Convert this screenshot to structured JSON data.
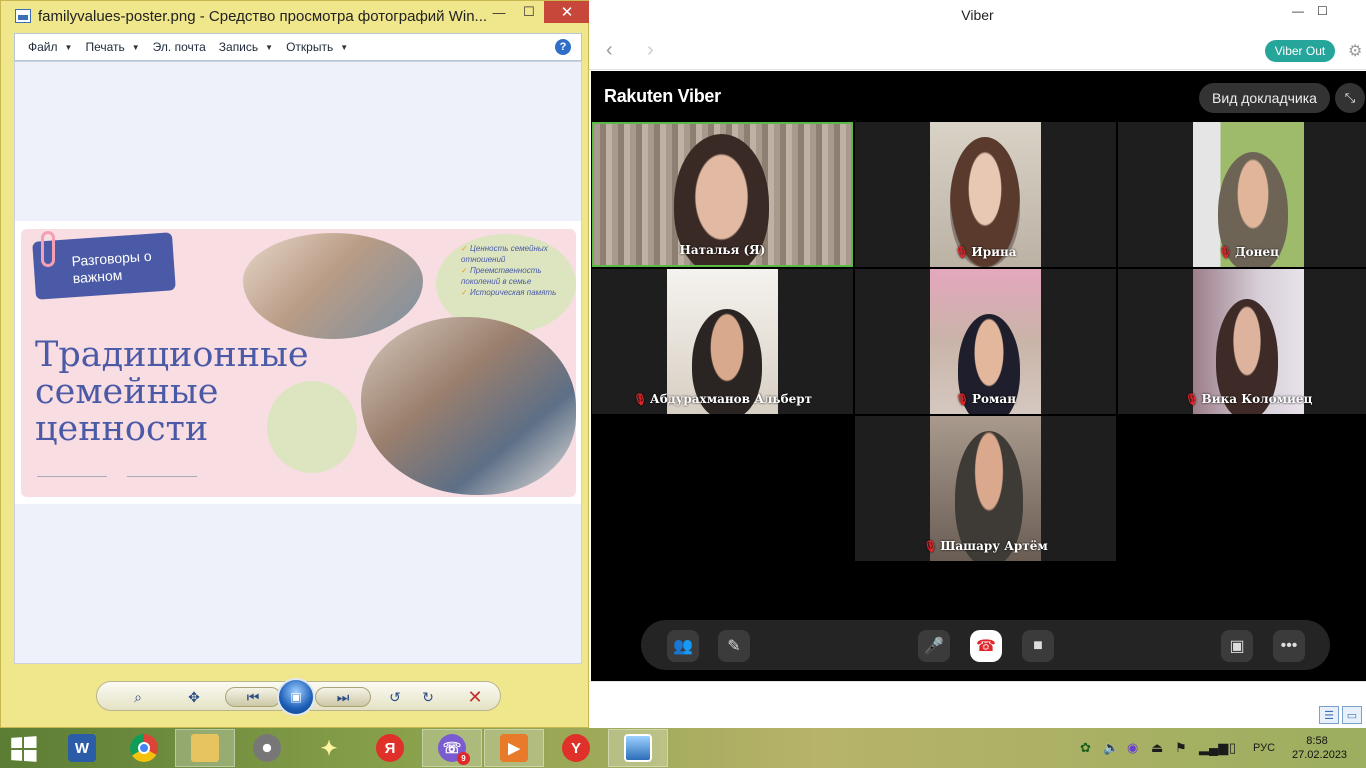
{
  "photo_viewer": {
    "title": "familyvalues-poster.png - Средство просмотра фотографий Win...",
    "menu": [
      {
        "label": "Файл",
        "has_caret": true
      },
      {
        "label": "Печать",
        "has_caret": true
      },
      {
        "label": "Эл. почта",
        "has_caret": false
      },
      {
        "label": "Запись",
        "has_caret": true
      },
      {
        "label": "Открыть",
        "has_caret": true
      }
    ],
    "poster": {
      "badge": "Разговоры о важном",
      "title_line1": "Традиционные",
      "title_line2": "семейные",
      "title_line3": "ценности",
      "list": [
        "Ценность семейных отношений",
        "Преемственность поколений в семье",
        "Историческая память"
      ]
    }
  },
  "viber": {
    "window_title": "Viber",
    "viber_out_label": "Viber Out",
    "brand": "Rakuten Viber",
    "speaker_view_label": "Вид докладчика",
    "participants": [
      {
        "name": "Наталья (Я)",
        "muted": false,
        "active": true
      },
      {
        "name": "Ирина",
        "muted": true,
        "active": false
      },
      {
        "name": "Донец",
        "muted": true,
        "active": false
      },
      {
        "name": "Абдурахманов Альберт",
        "muted": true,
        "active": false
      },
      {
        "name": "Роман",
        "muted": true,
        "active": false
      },
      {
        "name": "Вика Коломиец",
        "muted": true,
        "active": false
      },
      {
        "name": "Шашару Артём",
        "muted": true,
        "active": false
      }
    ],
    "controls": [
      "add-participant",
      "edit",
      "microphone",
      "end-call",
      "camera",
      "screen-share",
      "more"
    ],
    "colors": {
      "viber_out": "#26a59a",
      "active_border": "#5aba45",
      "end_call": "#e0262b"
    }
  },
  "taskbar": {
    "apps": [
      {
        "name": "word",
        "label": "W"
      },
      {
        "name": "chrome",
        "label": ""
      },
      {
        "name": "file-explorer",
        "label": ""
      },
      {
        "name": "media-center",
        "label": ""
      },
      {
        "name": "magic-wand",
        "label": ""
      },
      {
        "name": "yandex-browser",
        "label": "Я"
      },
      {
        "name": "viber",
        "label": "",
        "badge": "9"
      },
      {
        "name": "media-player",
        "label": ""
      },
      {
        "name": "yandex",
        "label": "Y"
      },
      {
        "name": "photo-viewer",
        "label": ""
      }
    ],
    "language": "РУС",
    "time": "8:58",
    "date": "27.02.2023"
  }
}
